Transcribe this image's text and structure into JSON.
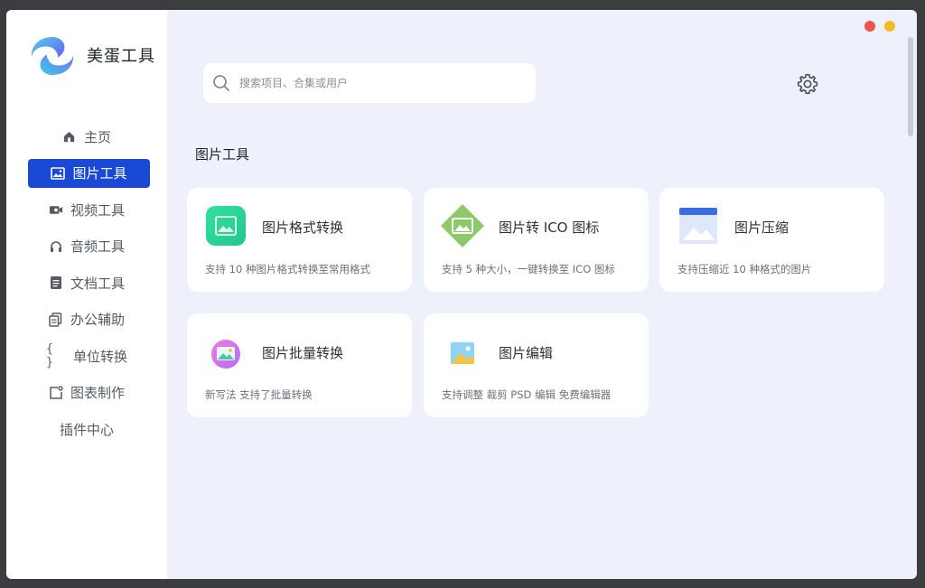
{
  "app": {
    "brand": "美蛋工具"
  },
  "sidebar": {
    "items": [
      {
        "label": "主页",
        "icon": "home-icon",
        "active": false
      },
      {
        "label": "图片工具",
        "icon": "image-icon",
        "active": true
      },
      {
        "label": "视频工具",
        "icon": "video-icon",
        "active": false
      },
      {
        "label": "音频工具",
        "icon": "headphones-icon",
        "active": false
      },
      {
        "label": "文档工具",
        "icon": "document-icon",
        "active": false
      },
      {
        "label": "办公辅助",
        "icon": "copy-icon",
        "active": false
      },
      {
        "label": "单位转换",
        "icon": "braces-icon",
        "active": false
      },
      {
        "label": "图表制作",
        "icon": "chart-icon",
        "active": false
      },
      {
        "label": "插件中心",
        "icon": "",
        "active": false
      }
    ]
  },
  "search": {
    "placeholder": "搜索项目、合集或用户"
  },
  "section": {
    "title": "图片工具"
  },
  "cards": [
    {
      "title": "图片格式转换",
      "desc": "支持 10 种图片格式转换至常用格式",
      "icon": "image-format-icon"
    },
    {
      "title": "图片转 ICO 图标",
      "desc": "支持 5 种大小，一键转换至 ICO 图标",
      "icon": "ico-convert-icon"
    },
    {
      "title": "图片压缩",
      "desc": "支持压缩近 10 种格式的图片",
      "icon": "image-compress-icon"
    },
    {
      "title": "图片批量转换",
      "desc": "新写法 支持了批量转换",
      "icon": "batch-convert-icon"
    },
    {
      "title": "图片编辑",
      "desc": "支持调整 裁剪 PSD 编辑 免费编辑器",
      "icon": "image-edit-icon"
    }
  ],
  "colors": {
    "accent": "#1a49d6",
    "close_dot": "#ef5350",
    "minimize_dot": "#f5b829",
    "background": "#eef1fb"
  }
}
